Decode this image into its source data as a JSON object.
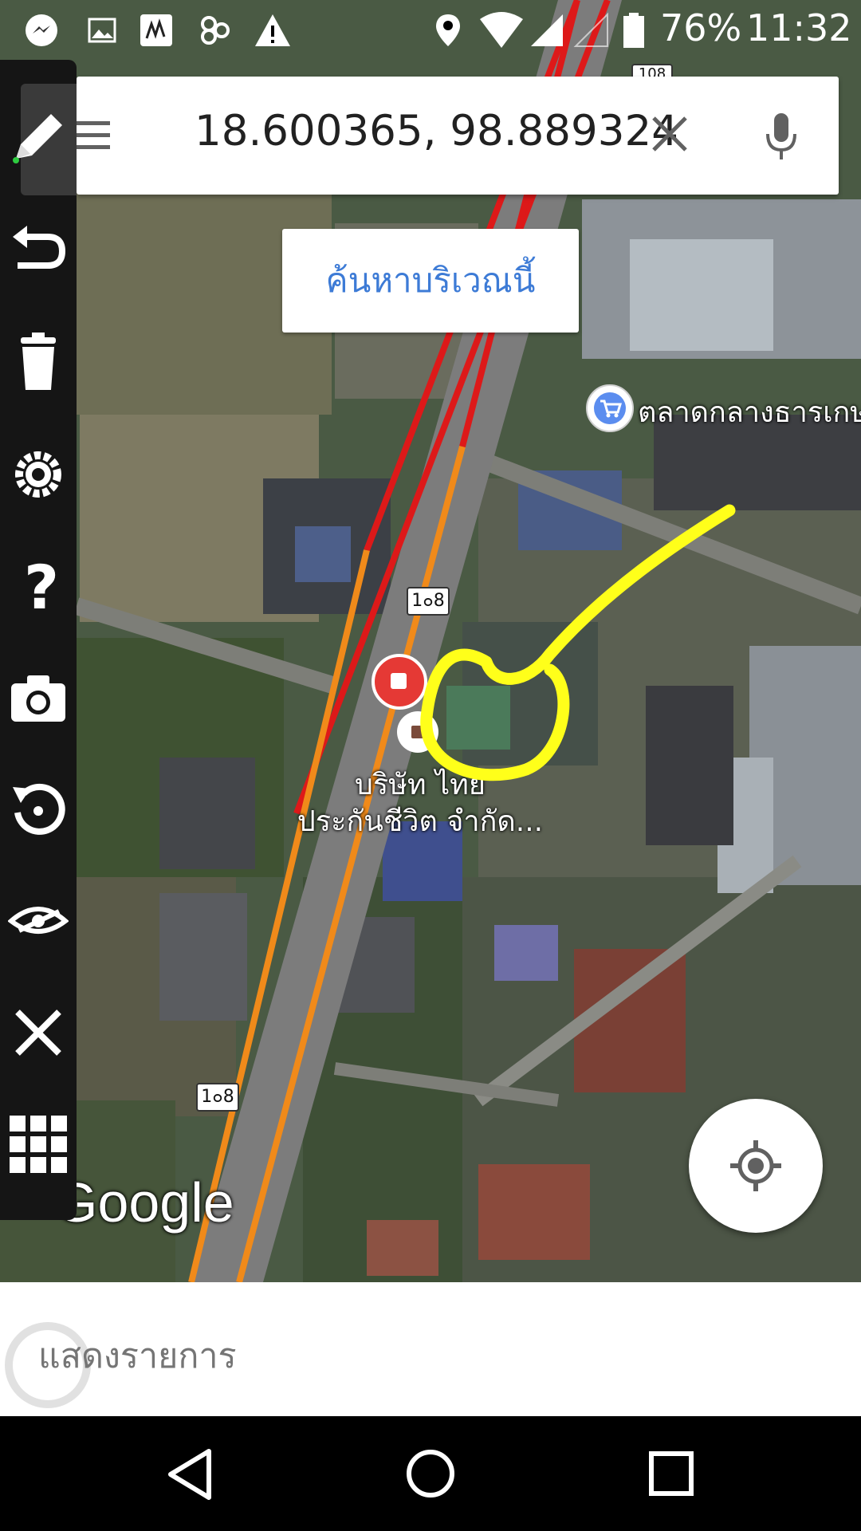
{
  "status_bar": {
    "battery": "76%",
    "time": "11:32",
    "icons": [
      "messenger-icon",
      "gallery-icon",
      "drawing-app-icon",
      "app-icon",
      "warning-icon",
      "location-icon",
      "wifi-icon",
      "signal-icon",
      "signal-empty-icon",
      "battery-icon"
    ]
  },
  "search": {
    "query": "18.600365, 98.889324",
    "menu_icon": "menu-icon",
    "clear_icon": "close-icon",
    "mic_icon": "microphone-icon"
  },
  "search_area_button": {
    "label": "ค้นหาบริเวณนี้"
  },
  "map": {
    "place_market": "ตลาดกลางธารเกษ",
    "place_company_line1": "บริษัท ไทย",
    "place_company_line2": "ประกันชีวิต จำกัด...",
    "road_shield_top": "108",
    "road_shield_mid": "1๐8",
    "road_shield_bottom": "1๐8",
    "attribution": "Google",
    "annotation_color": "#ffff1a"
  },
  "toolbar": {
    "tools": [
      "pencil-icon",
      "undo-icon",
      "trash-icon",
      "settings-icon",
      "help-icon",
      "camera-icon",
      "rotate-icon",
      "hide-icon",
      "close-icon",
      "grid-icon"
    ]
  },
  "list_panel": {
    "label": "แสดงรายการ"
  },
  "nav": {
    "buttons": [
      "back-icon",
      "home-icon",
      "recents-icon"
    ]
  }
}
